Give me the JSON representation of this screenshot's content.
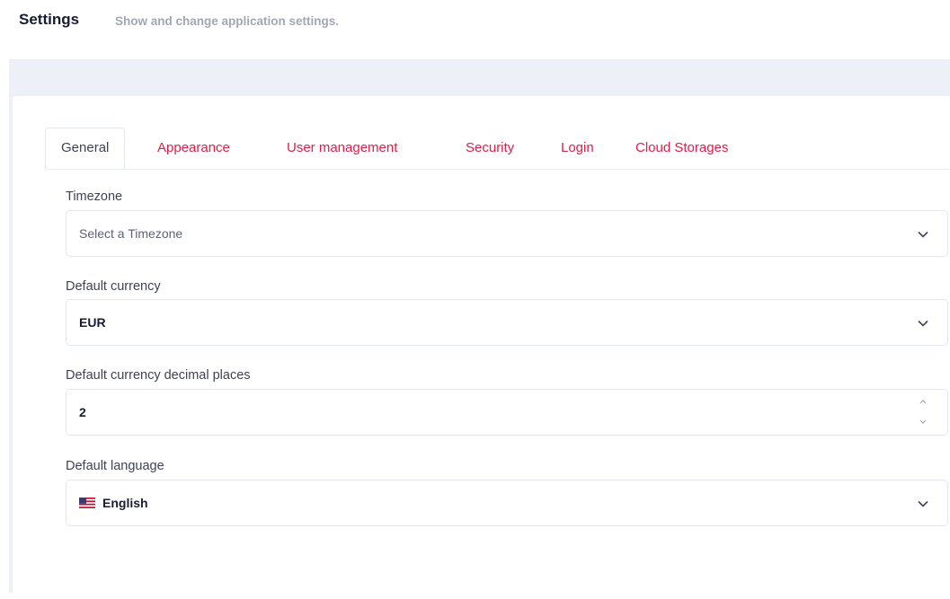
{
  "header": {
    "title": "Settings",
    "description": "Show and change application settings."
  },
  "tabs": [
    {
      "label": "General",
      "active": true
    },
    {
      "label": "Appearance",
      "active": false
    },
    {
      "label": "User management",
      "active": false
    },
    {
      "label": "Security",
      "active": false
    },
    {
      "label": "Login",
      "active": false
    },
    {
      "label": "Cloud Storages",
      "active": false
    }
  ],
  "form": {
    "timezone": {
      "label": "Timezone",
      "placeholder": "Select a Timezone",
      "value": ""
    },
    "currency": {
      "label": "Default currency",
      "value": "EUR"
    },
    "decimals": {
      "label": "Default currency decimal places",
      "value": "2"
    },
    "language": {
      "label": "Default language",
      "value": "English",
      "flag_icon": "us-flag-icon"
    }
  },
  "colors": {
    "accent": "#e11d48",
    "background": "#eef0f8",
    "border": "#e4e6ef",
    "text": "#3f4254",
    "muted": "#a3a6b4"
  }
}
